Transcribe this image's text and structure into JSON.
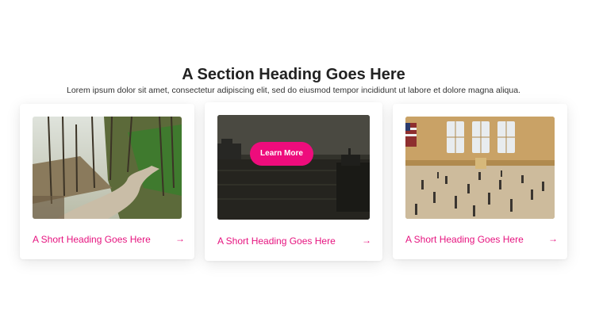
{
  "section": {
    "heading": "A Section Heading Goes Here",
    "subheading": "Lorem ipsum dolor sit amet, consectetur adipiscing elit, sed do eiusmod tempor incididunt ut labore et dolore magna aliqua."
  },
  "cards": [
    {
      "title": "A Short Heading Goes Here",
      "arrow": "→",
      "image": "forest-road-photo"
    },
    {
      "title": "A Short Heading Goes Here",
      "arrow": "→",
      "image": "harbor-photo",
      "button_label": "Learn More"
    },
    {
      "title": "A Short Heading Goes Here",
      "arrow": "→",
      "image": "train-station-concourse-photo"
    }
  ],
  "colors": {
    "accent": "#e6137f",
    "button": "#ee0c7c",
    "heading": "#222222"
  }
}
